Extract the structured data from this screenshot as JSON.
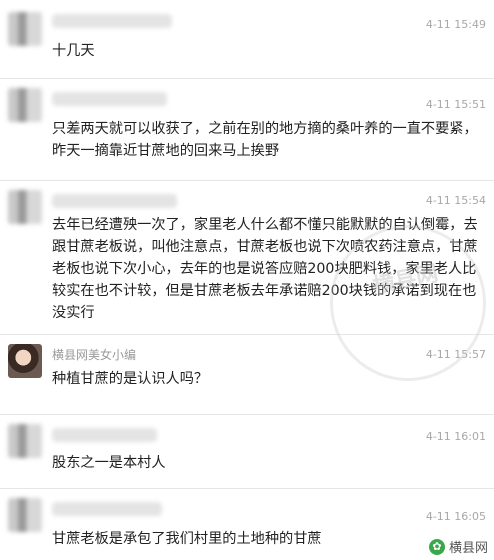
{
  "comments": [
    {
      "author": "",
      "time": "4-11 15:49",
      "text": "十几天"
    },
    {
      "author": "",
      "time": "4-11 15:51",
      "text": "只差两天就可以收获了，之前在别的地方摘的桑叶养的一直不要紧，昨天一摘靠近甘蔗地的回来马上挨野"
    },
    {
      "author": "",
      "time": "4-11 15:54",
      "text": "去年已经遭殃一次了，家里老人什么都不懂只能默默的自认倒霉，去跟甘蔗老板说，叫他注意点，甘蔗老板也说下次喷农药注意点，甘蔗老板也说下次小心，去年的也是说答应赔200块肥料钱，家里老人比较实在也不计较，但是甘蔗老板去年承诺赔200块钱的承诺到现在也没实行"
    },
    {
      "author": "横县网美女小编",
      "time": "4-11 15:57",
      "text": "种植甘蔗的是认识人吗？"
    },
    {
      "author": "",
      "time": "4-11 16:01",
      "text": "股东之一是本村人"
    },
    {
      "author": "",
      "time": "4-11 16:05",
      "text": "甘蔗老板是承包了我们村里的土地种的甘蔗"
    }
  ],
  "watermark": "横县网",
  "brand": {
    "label": "横县网",
    "icon": "wechat-icon"
  }
}
